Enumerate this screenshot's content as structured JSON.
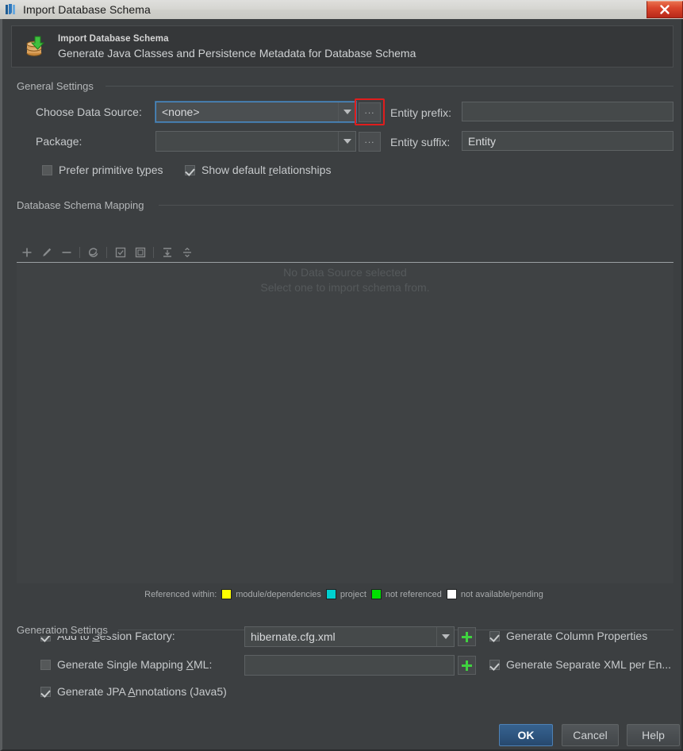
{
  "window": {
    "title": "Import Database Schema",
    "app_icon": "intellij-idea-icon",
    "close_label": "✕"
  },
  "banner": {
    "icon": "database-import-icon",
    "title": "Import Database Schema",
    "subtitle": "Generate Java Classes and Persistence Metadata for Database Schema"
  },
  "general_settings": {
    "group_label": "General Settings",
    "data_source_label": "Choose Data Source:",
    "data_source_value": "<none>",
    "data_source_browse": "...",
    "package_label": "Package:",
    "package_value": "",
    "package_browse": "...",
    "entity_prefix_label": "Entity prefix:",
    "entity_prefix_value": "",
    "entity_suffix_label": "Entity suffix:",
    "entity_suffix_value": "Entity",
    "prefer_primitive_label": "Prefer primitive types",
    "prefer_primitive_checked": false,
    "show_default_rel_label": "Show default relationships",
    "show_default_rel_checked": true
  },
  "mapping": {
    "group_label": "Database Schema Mapping",
    "toolbar": [
      {
        "name": "add-button",
        "icon": "plus-icon"
      },
      {
        "name": "edit-button",
        "icon": "pencil-icon"
      },
      {
        "name": "remove-button",
        "icon": "minus-icon"
      },
      {
        "name": "refresh-button",
        "icon": "refresh-icon"
      },
      {
        "name": "select-all-button",
        "icon": "checked-square-icon"
      },
      {
        "name": "deselect-all-button",
        "icon": "empty-square-icon"
      },
      {
        "name": "expand-all-button",
        "icon": "expand-all-icon"
      },
      {
        "name": "collapse-all-button",
        "icon": "collapse-all-icon"
      }
    ],
    "empty_title": "No Data Source selected",
    "empty_subtitle": "Select one to import schema from."
  },
  "legend": {
    "title": "Referenced within:",
    "items": [
      {
        "color": "#ffff00",
        "label": "module/dependencies"
      },
      {
        "color": "#00d0d0",
        "label": "project"
      },
      {
        "color": "#00e000",
        "label": "not referenced"
      },
      {
        "color": "#ffffff",
        "label": "not available/pending"
      }
    ]
  },
  "generation_settings": {
    "group_label": "Generation Settings",
    "session_factory_label": "Add to Session Factory:",
    "session_factory_checked": true,
    "session_factory_value": "hibernate.cfg.xml",
    "session_factory_add": "+",
    "single_mapping_label": "Generate Single Mapping XML:",
    "single_mapping_checked": false,
    "single_mapping_value": "",
    "single_mapping_add": "+",
    "jpa_annotations_label": "Generate JPA Annotations (Java5)",
    "jpa_annotations_checked": true,
    "column_properties_label": "Generate Column Properties",
    "column_properties_checked": true,
    "separate_xml_label": "Generate Separate XML per En...",
    "separate_xml_checked": true
  },
  "footer": {
    "ok": "OK",
    "cancel": "Cancel",
    "help": "Help"
  },
  "highlight": {
    "color": "#e01d1d",
    "target": "data-source-browse-button"
  }
}
